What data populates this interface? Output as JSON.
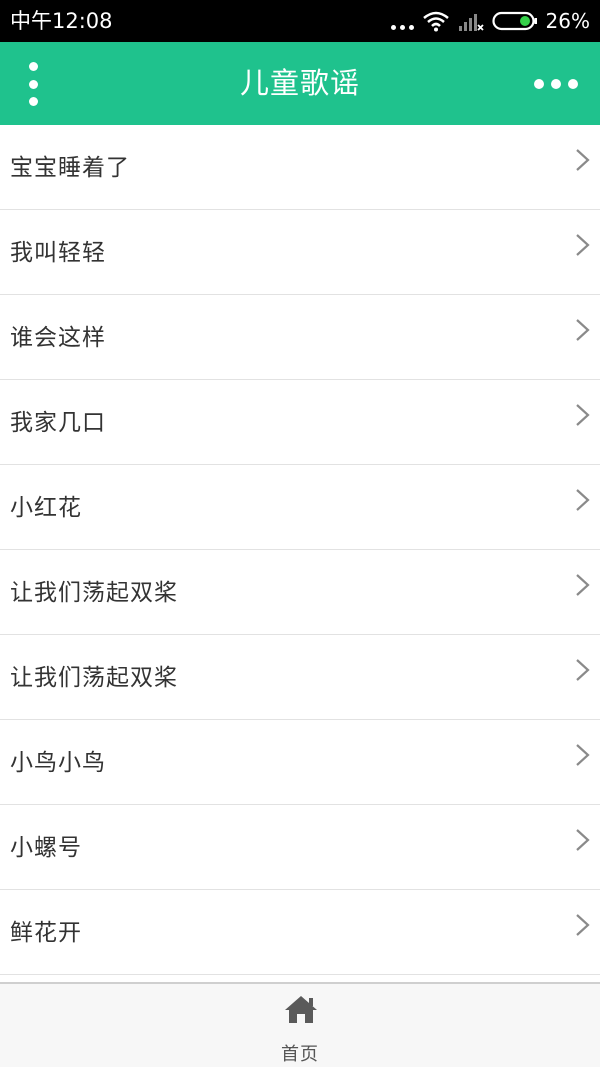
{
  "status_bar": {
    "time": "中午12:08",
    "battery": "26%",
    "icons": [
      "more-dots-icon",
      "wifi-icon",
      "signal-icon",
      "battery-icon"
    ]
  },
  "header": {
    "title": "儿童歌谣",
    "left_icon": "vertical-dots-menu-icon",
    "right_icon": "horizontal-dots-more-icon",
    "background_color": "#1fc28d"
  },
  "songs": [
    {
      "label": "宝宝睡着了"
    },
    {
      "label": "我叫轻轻"
    },
    {
      "label": "谁会这样"
    },
    {
      "label": "我家几口"
    },
    {
      "label": "小红花"
    },
    {
      "label": "让我们荡起双桨"
    },
    {
      "label": "让我们荡起双桨"
    },
    {
      "label": "小鸟小鸟"
    },
    {
      "label": "小螺号"
    },
    {
      "label": "鲜花开"
    }
  ],
  "tab_bar": {
    "tabs": [
      {
        "label": "首页",
        "icon": "home-icon",
        "active": true
      }
    ]
  }
}
